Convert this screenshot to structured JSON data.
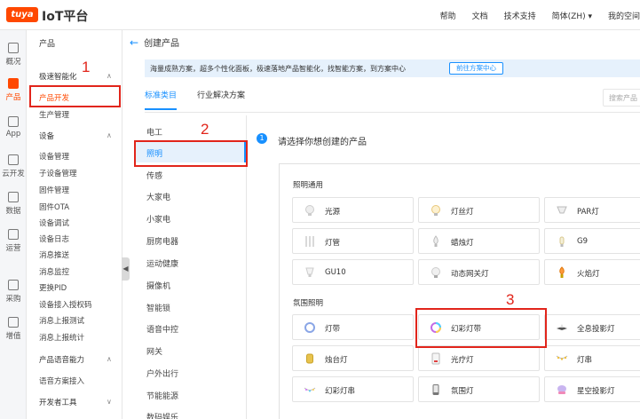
{
  "topbar": {
    "logo": "tuya",
    "title": "IoT平台",
    "nav": [
      "帮助",
      "文档",
      "技术支持",
      "简体(ZH) ▾",
      "我的空间"
    ]
  },
  "rail": [
    {
      "label": "概况",
      "icon": "overview-icon"
    },
    {
      "label": "产品",
      "icon": "product-icon",
      "active": true
    },
    {
      "label": "App",
      "icon": "app-icon"
    },
    {
      "label": "云开发",
      "icon": "cloud-icon"
    },
    {
      "label": "数据",
      "icon": "data-icon"
    },
    {
      "label": "运营",
      "icon": "operation-icon"
    },
    {
      "label": "采购",
      "icon": "purchase-icon"
    },
    {
      "label": "增值",
      "icon": "value-added-icon"
    }
  ],
  "menu": {
    "title": "产品",
    "items": [
      {
        "label": "极速智能化",
        "type": "group",
        "caret": "∧"
      },
      {
        "label": "产品开发",
        "type": "item",
        "selected": true
      },
      {
        "label": "生产管理",
        "type": "item"
      },
      {
        "label": "设备",
        "type": "group",
        "caret": "∧"
      },
      {
        "label": "设备管理",
        "type": "item"
      },
      {
        "label": "子设备管理",
        "type": "item"
      },
      {
        "label": "固件管理",
        "type": "item"
      },
      {
        "label": "固件OTA",
        "type": "item"
      },
      {
        "label": "设备调试",
        "type": "item"
      },
      {
        "label": "设备日志",
        "type": "item"
      },
      {
        "label": "消息推送",
        "type": "item"
      },
      {
        "label": "消息监控",
        "type": "item"
      },
      {
        "label": "更换PID",
        "type": "item"
      },
      {
        "label": "设备接入授权码",
        "type": "item"
      },
      {
        "label": "消息上报测试",
        "type": "item"
      },
      {
        "label": "消息上报统计",
        "type": "item"
      },
      {
        "label": "产品语音能力",
        "type": "group",
        "caret": "∧"
      },
      {
        "label": "语音方案接入",
        "type": "item"
      },
      {
        "label": "开发者工具",
        "type": "group",
        "caret": "∨"
      }
    ]
  },
  "main": {
    "back_label": "创建产品",
    "banner_text": "海量成熟方案，超多个性化面板，极速落地产品智能化，找智能方案，到方案中心",
    "banner_button": "前往方案中心",
    "tabs": [
      "标准类目",
      "行业解决方案"
    ],
    "search_placeholder": "搜索产品",
    "step_number": "1",
    "step_title": "请选择你想创建的产品"
  },
  "categories": [
    "电工",
    "照明",
    "传感",
    "大家电",
    "小家电",
    "厨房电器",
    "运动健康",
    "摄像机",
    "智能锁",
    "语音中控",
    "网关",
    "户外出行",
    "节能能源",
    "数码娱乐"
  ],
  "sections": [
    {
      "title": "照明通用",
      "products": [
        "光源",
        "灯丝灯",
        "PAR灯",
        "灯管",
        "蜡烛灯",
        "G9",
        "GU10",
        "动态网关灯",
        "火焰灯"
      ]
    },
    {
      "title": "氛围照明",
      "products": [
        "灯带",
        "幻彩灯带",
        "全息投影灯",
        "烛台灯",
        "光疗灯",
        "灯串",
        "幻彩灯串",
        "氛围灯",
        "星空投影灯"
      ]
    }
  ],
  "annotations": [
    "1",
    "2",
    "3"
  ],
  "colors": {
    "brand": "#ff4800",
    "accent": "#1890ff",
    "annotation": "#e1251b"
  }
}
